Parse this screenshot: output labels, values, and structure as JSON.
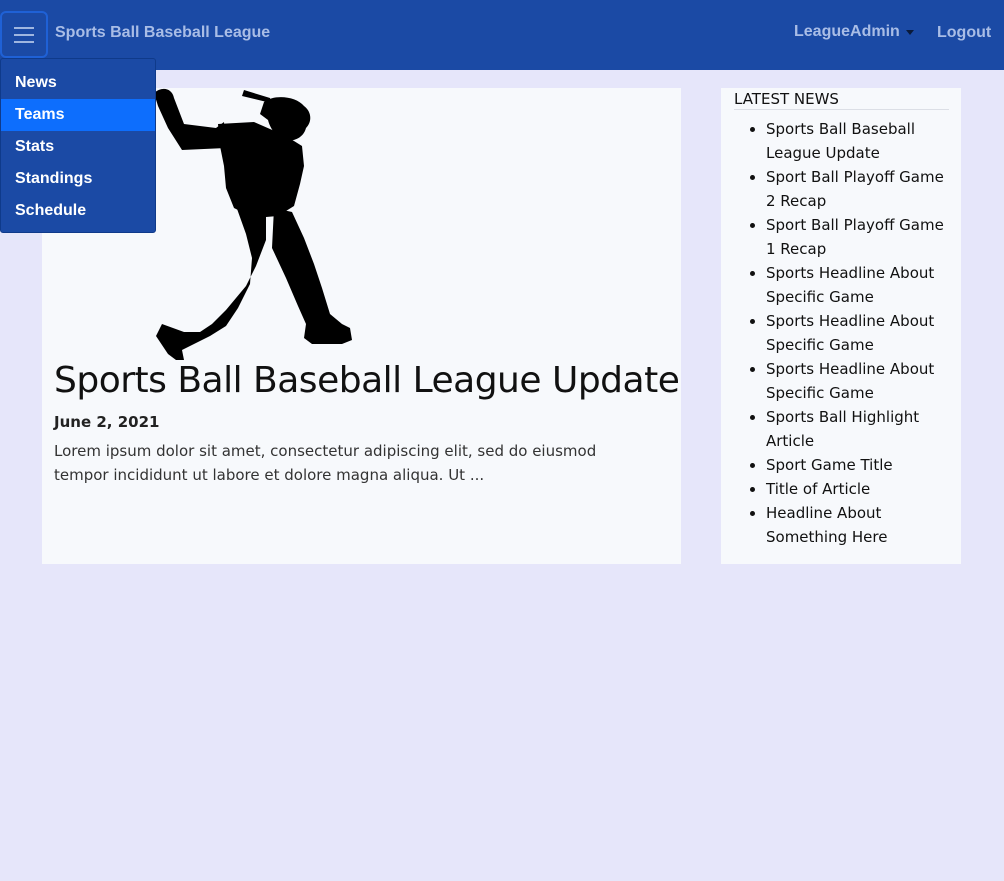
{
  "header": {
    "brand": "Sports Ball Baseball League",
    "user": "LeagueAdmin",
    "logout": "Logout"
  },
  "menu": {
    "items": [
      {
        "label": "News",
        "active": false
      },
      {
        "label": "Teams",
        "active": true
      },
      {
        "label": "Stats",
        "active": false
      },
      {
        "label": "Standings",
        "active": false
      },
      {
        "label": "Schedule",
        "active": false
      }
    ]
  },
  "article": {
    "title": "Sports Ball Baseball League Update",
    "date": "June 2, 2021",
    "excerpt": "Lorem ipsum dolor sit amet, consectetur adipiscing elit, sed do eiusmod tempor incididunt ut labore et dolore magna aliqua. Ut ..."
  },
  "latest_news": {
    "heading": "LATEST NEWS",
    "items": [
      "Sports Ball Baseball League Update",
      "Sport Ball Playoff Game 2 Recap",
      "Sport Ball Playoff Game 1 Recap",
      "Sports Headline About Specific Game",
      "Sports Headline About Specific Game",
      "Sports Headline About Specific Game",
      "Sports Ball Highlight Article",
      "Sport Game Title",
      "Title of Article",
      "Headline About Something Here"
    ]
  },
  "colors": {
    "navbar": "#1b4aa5",
    "active_menu": "#0d6efd",
    "background": "#e6e6fa",
    "card": "#f7f9fc"
  },
  "icons": {
    "menu_toggle": "hamburger-icon",
    "dropdown": "caret-down-icon",
    "article_image": "baseball-batter-silhouette"
  }
}
